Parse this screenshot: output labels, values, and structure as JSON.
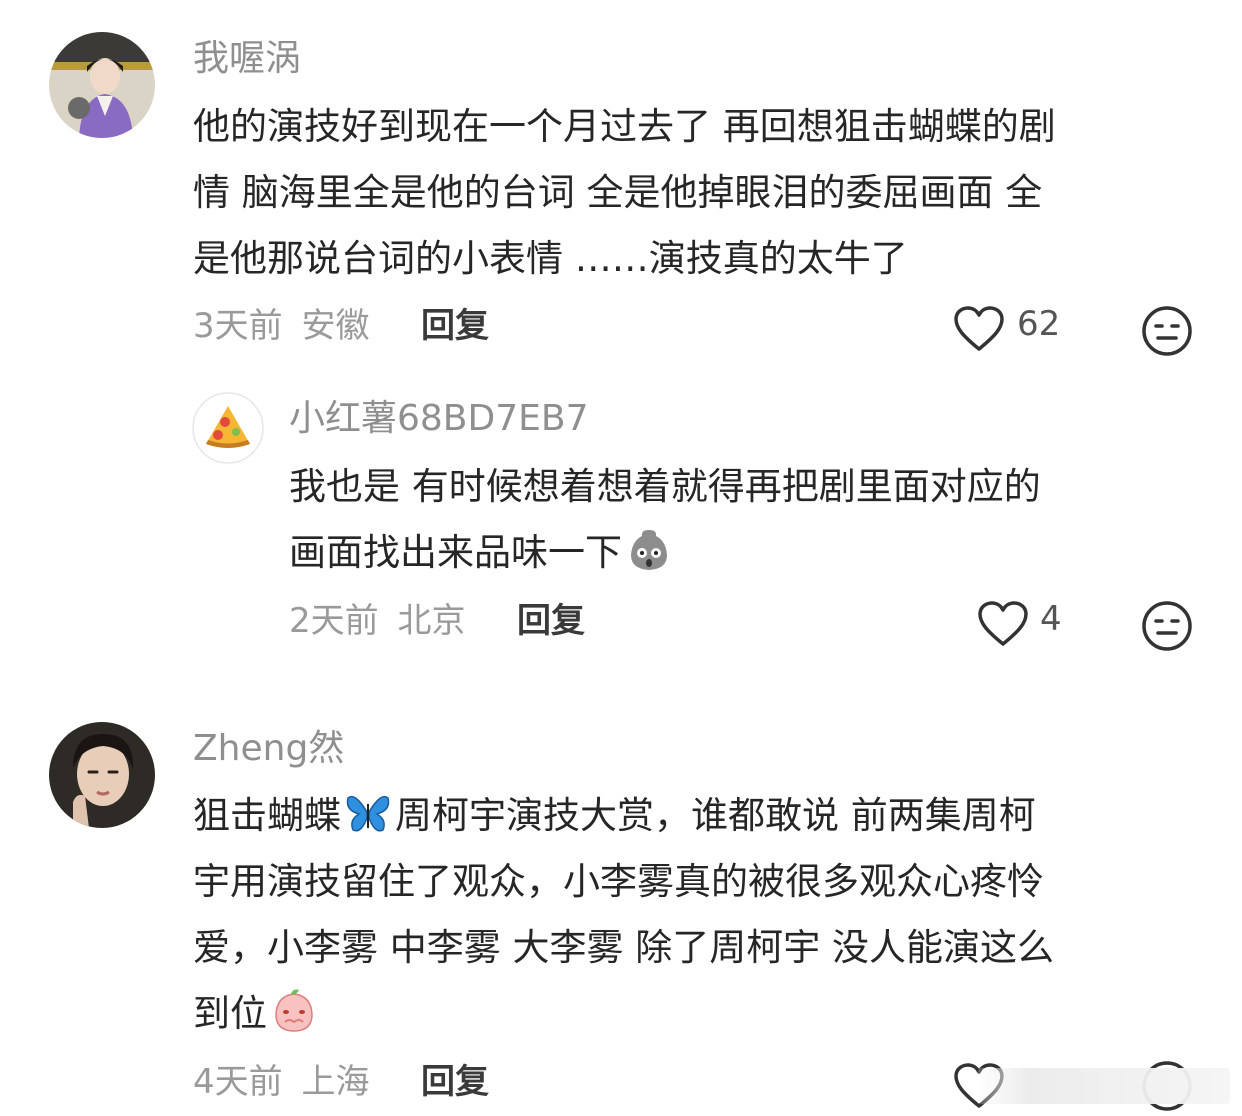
{
  "comments": [
    {
      "username": "我喔涡",
      "text_lines": [
        "他的演技好到现在一个月过去了 再回想狙击蝴蝶的剧",
        "情 脑海里全是他的台词 全是他掉眼泪的委屈画面 全",
        "是他那说台词的小表情 ……演技真的太牛了"
      ],
      "time": "3天前",
      "location": "安徽",
      "reply_label": "回复",
      "likes": "62",
      "reply": {
        "username": "小红薯68BD7EB7",
        "text_lines": [
          "我也是 有时候想着想着就得再把剧里面对应的",
          "画面找出来品味一下"
        ],
        "time": "2天前",
        "location": "北京",
        "reply_label": "回复",
        "likes": "4"
      }
    },
    {
      "username": "Zheng然",
      "line1_a": "狙击蝴蝶",
      "line1_b": "周柯宇演技大赏，谁都敢说 前两集周柯",
      "text_lines": [
        "宇用演技留住了观众，小李雾真的被很多观众心疼怜",
        "爱，小李雾 中李雾 大李雾 除了周柯宇 没人能演这么"
      ],
      "last_line": "到位",
      "time": "4天前",
      "location": "上海",
      "reply_label": "回复"
    }
  ],
  "colors": {
    "username": "#8f8f8f",
    "body_text": "#262626",
    "meta": "#9a9a9a",
    "icon": "#333333"
  }
}
